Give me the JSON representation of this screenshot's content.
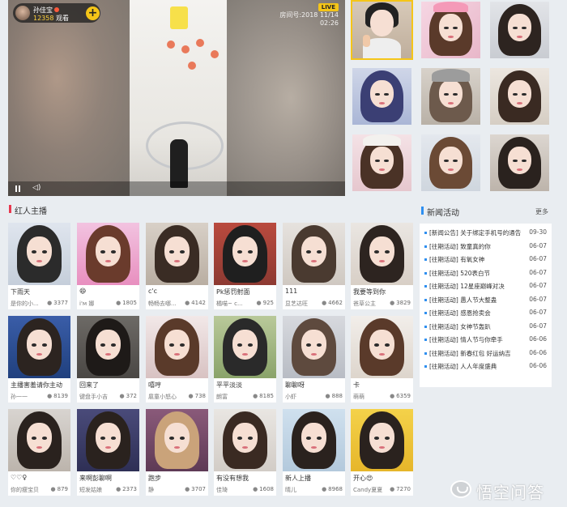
{
  "player": {
    "host_name": "孙佳宝",
    "viewer_count": "12358",
    "viewer_suffix": "观看",
    "follow_label": "+",
    "live_label": "LIVE",
    "room_line1": "房间号:2018 11/14",
    "room_line2": "02:26",
    "volume_icon": "speaker-icon"
  },
  "sections": {
    "streamers_title": "红人主播",
    "news_title": "新闻活动",
    "news_more": "更多"
  },
  "streamers": [
    {
      "caption": "下雨天",
      "user": "是你的小...",
      "count": "3377"
    },
    {
      "caption": "😄",
      "user": "i'м 娜",
      "count": "1805"
    },
    {
      "caption": "c'c",
      "user": "畅畅去哪...",
      "count": "4142"
    },
    {
      "caption": "Pk惩罚射面",
      "user": "橘喵~ c...",
      "count": "925"
    },
    {
      "caption": "111",
      "user": "显艺达旺",
      "count": "4662"
    },
    {
      "caption": "我要等到你",
      "user": "爸草公主",
      "count": "3829"
    },
    {
      "caption": "主播害羞请你主动",
      "user": "孙一一",
      "count": "8139"
    },
    {
      "caption": "回来了",
      "user": "键盘手小吉",
      "count": "372"
    },
    {
      "caption": "嘻哼",
      "user": "扈童小怒心",
      "count": "738"
    },
    {
      "caption": "平平淡淡",
      "user": "朗富",
      "count": "8185"
    },
    {
      "caption": "聊聊呀",
      "user": "小虾",
      "count": "888"
    },
    {
      "caption": "卡",
      "user": "萌萌",
      "count": "6359"
    },
    {
      "caption": "♡♡♀",
      "user": "你的瘦宝贝",
      "count": "879"
    },
    {
      "caption": "来啊彭聊啊",
      "user": "短发姑娘",
      "count": "2373"
    },
    {
      "caption": "跑步",
      "user": "静",
      "count": "3707"
    },
    {
      "caption": "有没有想我",
      "user": "佳琦",
      "count": "1608"
    },
    {
      "caption": "新人上播",
      "user": "晴儿",
      "count": "8968"
    },
    {
      "caption": "开心😍",
      "user": "Candy夏夏",
      "count": "7270"
    }
  ],
  "news": [
    {
      "title": "[新闻公告] 关于绑定手机号的通告",
      "date": "09-30"
    },
    {
      "title": "[往期活动] 致童真的你",
      "date": "06-07"
    },
    {
      "title": "[往期活动] 有氧女神",
      "date": "06-07"
    },
    {
      "title": "[往期活动] 520表白节",
      "date": "06-07"
    },
    {
      "title": "[往期活动] 12星座巅峰对决",
      "date": "06-07"
    },
    {
      "title": "[往期活动] 愚人节大整蛊",
      "date": "06-07"
    },
    {
      "title": "[往期活动] 感恩抢卖会",
      "date": "06-07"
    },
    {
      "title": "[往期活动] 女神节轰趴",
      "date": "06-07"
    },
    {
      "title": "[往期活动] 情人节与你牵手",
      "date": "06-06"
    },
    {
      "title": "[往期活动] 新春红包 好运纳吉",
      "date": "06-06"
    },
    {
      "title": "[往期活动] 人人年度盛典",
      "date": "06-06"
    }
  ],
  "watermark": {
    "text": "悟空问答",
    "icon": "wukong-logo-icon"
  }
}
